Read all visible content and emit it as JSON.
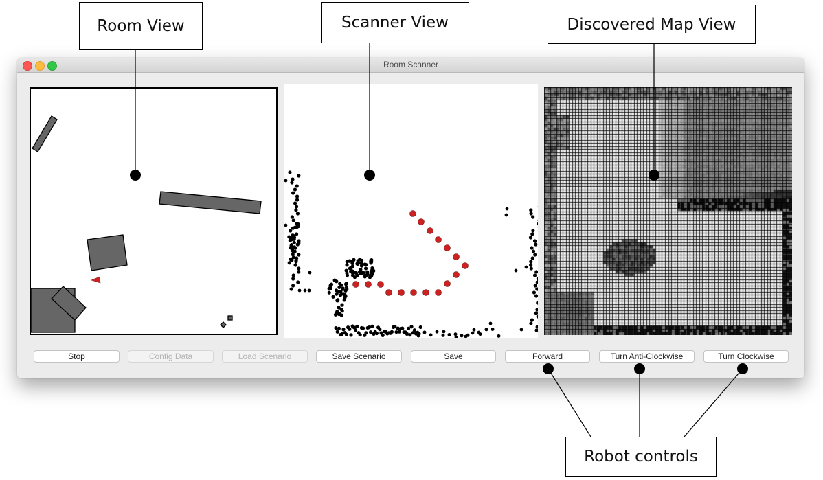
{
  "annotations": {
    "room_view": "Room View",
    "scanner_view": "Scanner View",
    "map_view": "Discovered Map View",
    "robot_controls": "Robot controls"
  },
  "window": {
    "title": "Room Scanner",
    "traffic_lights": [
      "close",
      "minimize",
      "zoom"
    ]
  },
  "room_view": {
    "obstacles": [
      "bar-top-left",
      "long-bar",
      "square-box",
      "corner-block",
      "tilted-box",
      "small-box-1",
      "small-box-2"
    ],
    "robot_icon": "red-triangle"
  },
  "scanner_view": {
    "scan_points_color": "#000000",
    "path_points_color": "#cc2222"
  },
  "map_view": {
    "grid": "occupancy-grid"
  },
  "buttons": [
    {
      "id": "stop",
      "label": "Stop",
      "enabled": true
    },
    {
      "id": "config-data",
      "label": "Config Data",
      "enabled": false
    },
    {
      "id": "load-scenario",
      "label": "Load Scenario",
      "enabled": false
    },
    {
      "id": "save-scenario",
      "label": "Save Scenario",
      "enabled": true
    },
    {
      "id": "save",
      "label": "Save",
      "enabled": true
    },
    {
      "id": "forward",
      "label": "Forward",
      "enabled": true
    },
    {
      "id": "turn-anticlockwise",
      "label": "Turn Anti-Clockwise",
      "enabled": true
    },
    {
      "id": "turn-clockwise",
      "label": "Turn Clockwise",
      "enabled": true
    }
  ],
  "colors": {
    "obstacle_fill": "#666666",
    "robot": "#cc2222",
    "window_bg": "#ececec"
  }
}
